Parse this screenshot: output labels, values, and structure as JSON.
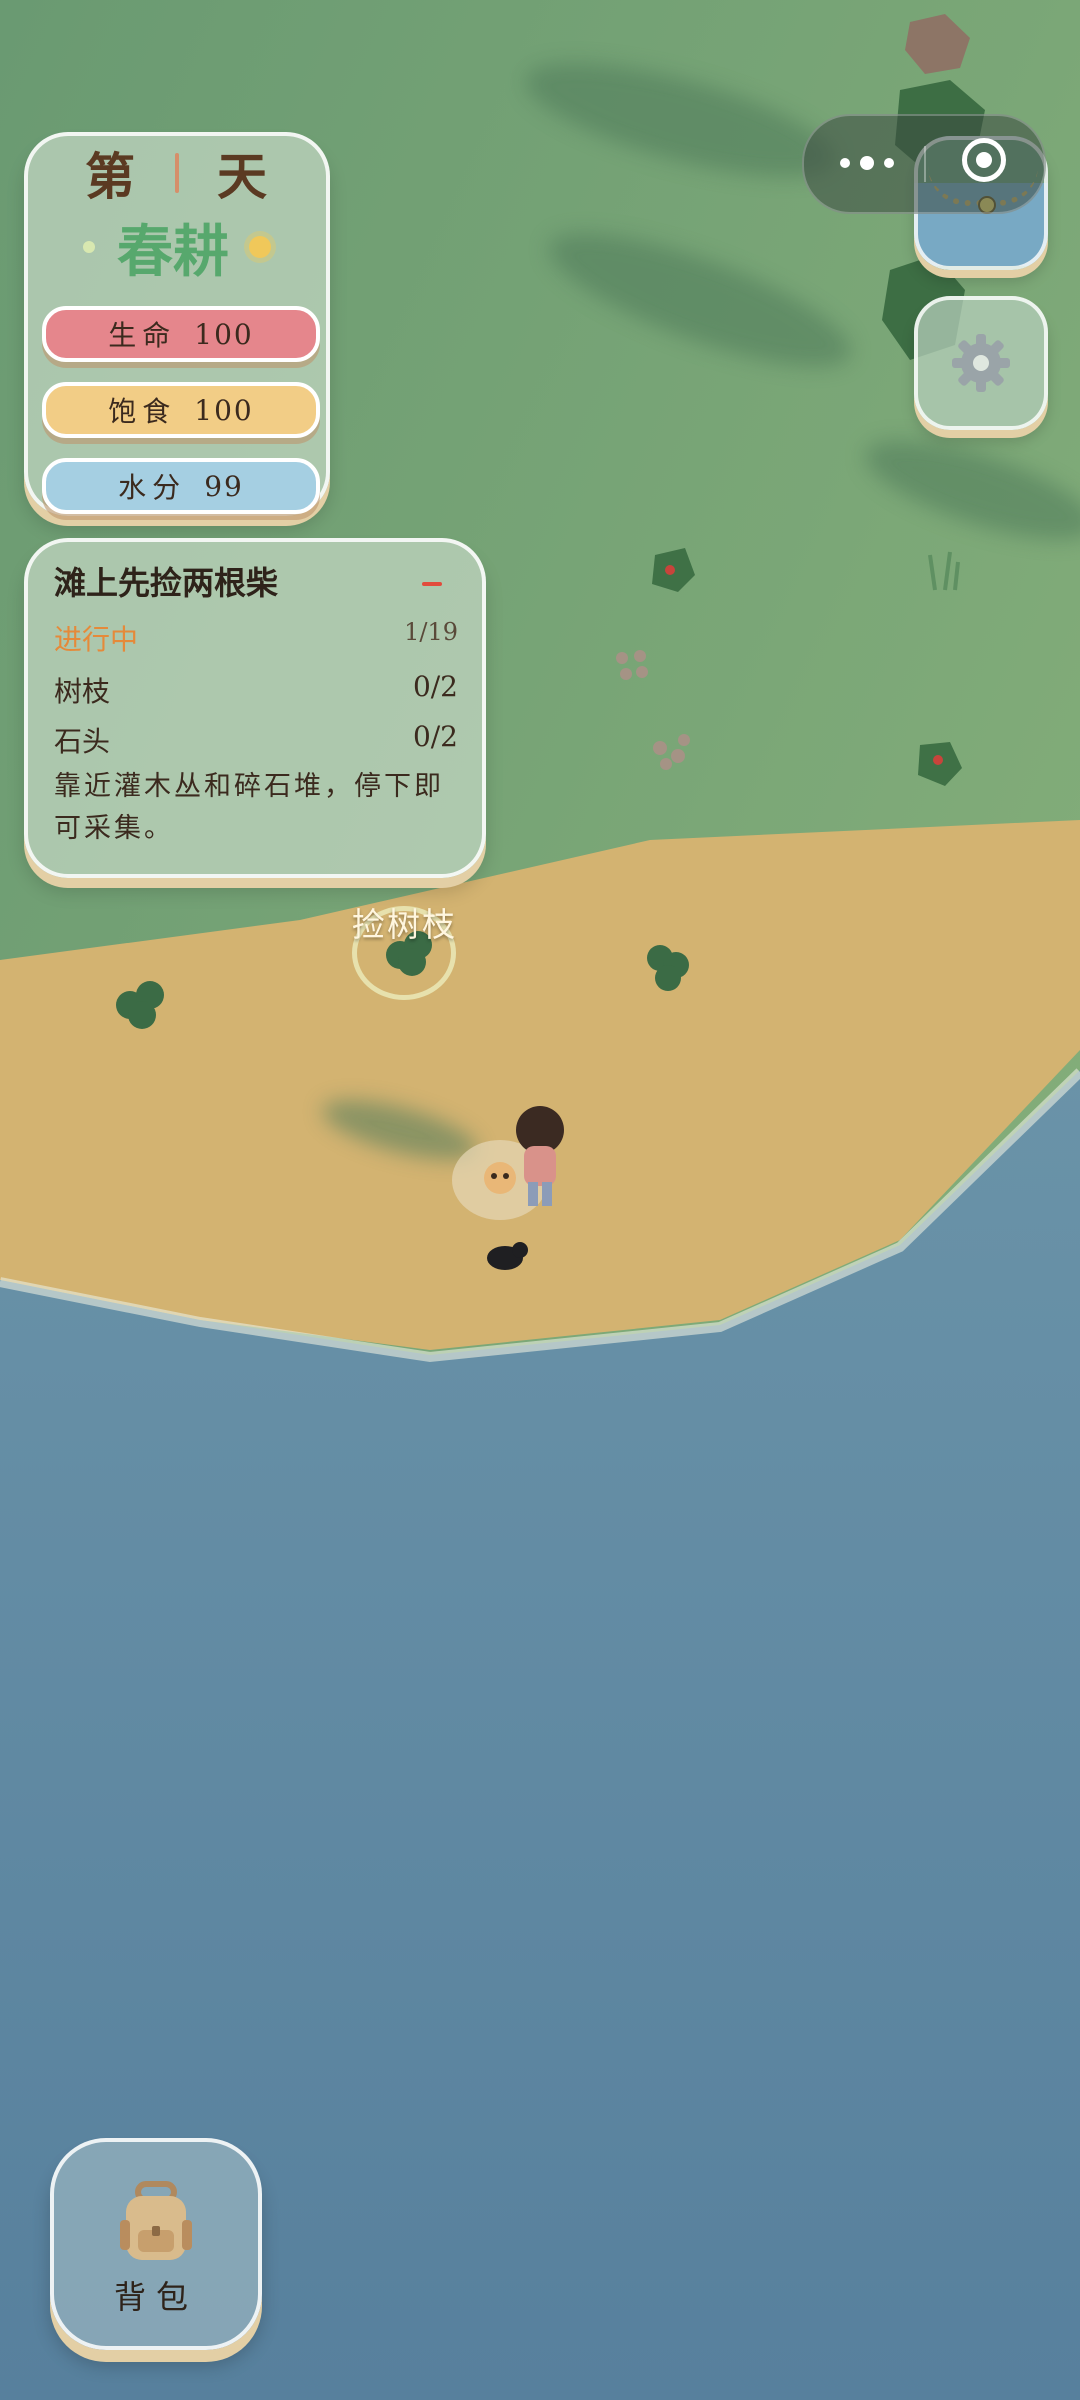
{
  "day_panel": {
    "day_prefix": "第",
    "day_suffix": "天",
    "season": "春耕",
    "stats": [
      {
        "label": "生命",
        "value": "100",
        "color": "#e5868c"
      },
      {
        "label": "饱食",
        "value": "100",
        "color": "#f2cd86"
      },
      {
        "label": "水分",
        "value": "99",
        "color": "#a5cfe2"
      }
    ]
  },
  "quest": {
    "title": "滩上先捡两根柴",
    "status_label": "进行中",
    "progress": "1/19",
    "tasks": [
      {
        "name": "树枝",
        "count": "0/2"
      },
      {
        "name": "石头",
        "count": "0/2"
      }
    ],
    "description": "靠近灌木丛和碎石堆，停下即可采集。"
  },
  "action_prompt": "捡树枝",
  "backpack": {
    "label": "背包"
  },
  "icons": {
    "menu": "more-dots-icon",
    "close": "target-circle-icon",
    "map": "minimap-icon",
    "settings": "gear-icon",
    "backpack": "backpack-icon"
  },
  "colors": {
    "grass": "#76a277",
    "sand": "#d4b26e",
    "sea": "#5f87a2",
    "accent_orange": "#e58a3a",
    "season_green": "#57a86d"
  }
}
